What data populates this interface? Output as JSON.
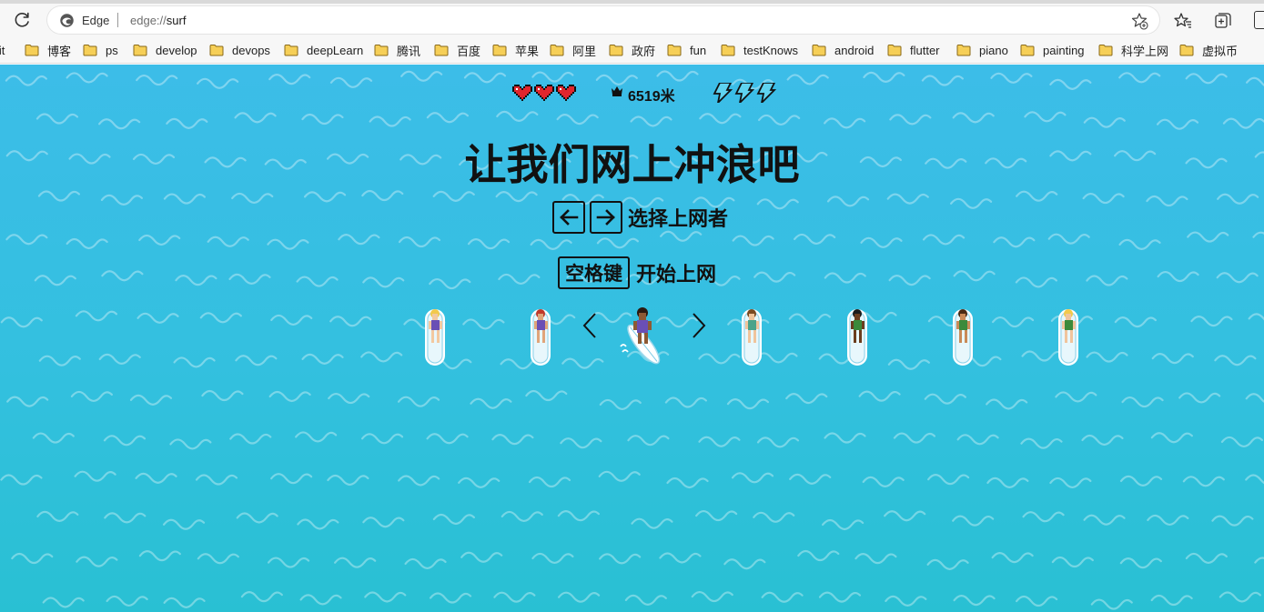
{
  "browser": {
    "brand": "Edge",
    "url_scheme": "edge://",
    "url_path": "surf",
    "icons": {
      "reload": "reload-icon",
      "logo": "edge-logo-icon",
      "add_favorite": "add-favorite-icon",
      "favorites": "favorites-icon",
      "collections": "collections-icon"
    }
  },
  "bookmarks": [
    {
      "label": "lit"
    },
    {
      "label": "博客"
    },
    {
      "label": "ps"
    },
    {
      "label": "develop"
    },
    {
      "label": "devops"
    },
    {
      "label": "deepLearn"
    },
    {
      "label": "腾讯"
    },
    {
      "label": "百度"
    },
    {
      "label": "苹果"
    },
    {
      "label": "阿里"
    },
    {
      "label": "政府"
    },
    {
      "label": "fun"
    },
    {
      "label": "testKnows"
    },
    {
      "label": "android"
    },
    {
      "label": "flutter"
    },
    {
      "label": "piano"
    },
    {
      "label": "painting"
    },
    {
      "label": "科学上网"
    },
    {
      "label": "虚拟币"
    }
  ],
  "game": {
    "hud": {
      "lives": 3,
      "distance_text": "6519米",
      "boosts": 3
    },
    "title": "让我们网上冲浪吧",
    "select_hint": "选择上网者",
    "space_key_label": "空格键",
    "start_hint": "开始上网",
    "surfers": [
      {
        "name": "blonde-woman-surfer",
        "hair": "#f2c94c",
        "skin": "#f3c9a0",
        "outfit": "#6a4fb5",
        "selected": false
      },
      {
        "name": "redhead-woman-surfer",
        "hair": "#c0392b",
        "skin": "#e0a57a",
        "outfit": "#6a4fb5",
        "selected": false
      },
      {
        "name": "curly-woman-surfer",
        "hair": "#2b1a10",
        "skin": "#8d5a34",
        "outfit": "#6a4fb5",
        "selected": true
      },
      {
        "name": "brown-hair-surfer",
        "hair": "#7a4a22",
        "skin": "#f0c49c",
        "outfit": "#4aa38a",
        "selected": false
      },
      {
        "name": "dark-skin-man-surfer",
        "hair": "#1b1b1b",
        "skin": "#6b3d1e",
        "outfit": "#3b8a3b",
        "selected": false
      },
      {
        "name": "tan-man-surfer",
        "hair": "#4a2a14",
        "skin": "#c98a58",
        "outfit": "#3b8a3b",
        "selected": false
      },
      {
        "name": "blonde-man-surfer",
        "hair": "#f2c94c",
        "skin": "#f0c49c",
        "outfit": "#3b8a3b",
        "selected": false
      }
    ],
    "colors": {
      "water_top": "#3cbde8",
      "water_bottom": "#29c0d3",
      "heart": "#e0262d"
    }
  }
}
